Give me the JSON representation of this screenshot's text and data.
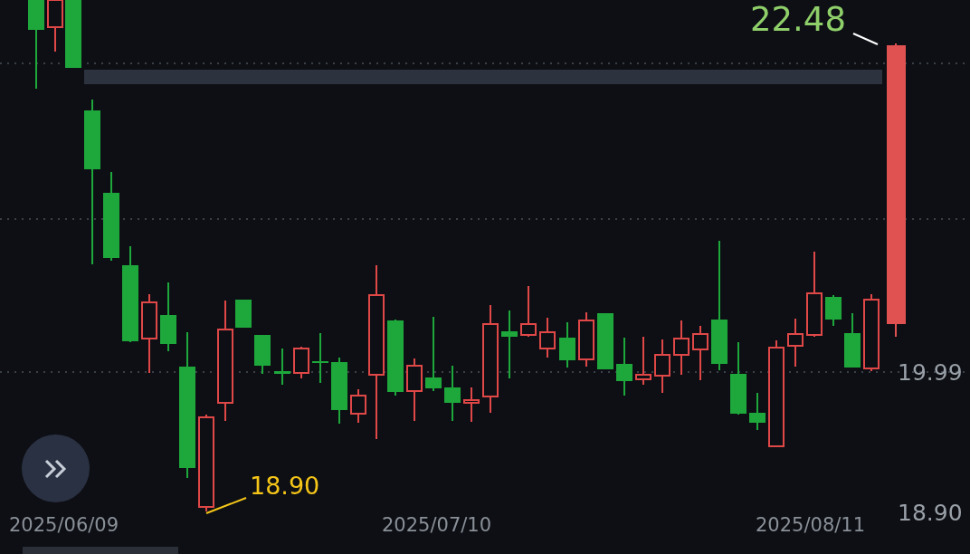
{
  "price_marker_high": {
    "value": "22.48"
  },
  "price_marker_low": {
    "value": "18.90"
  },
  "y_axis": {
    "labels": [
      "19.99",
      "18.90"
    ]
  },
  "x_axis": {
    "labels": [
      "2025/06/09",
      "2025/07/10",
      "2025/08/11"
    ]
  }
}
